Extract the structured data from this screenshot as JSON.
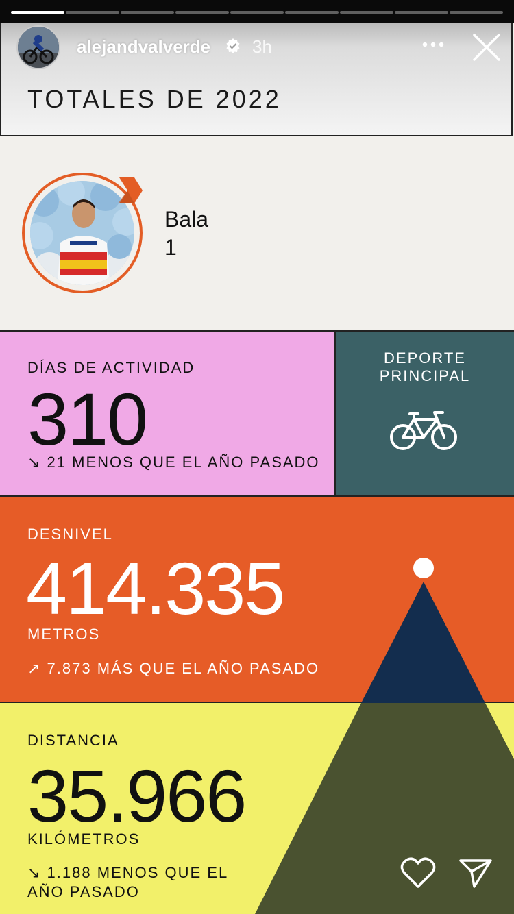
{
  "story": {
    "progress_segments": [
      1,
      0,
      0,
      0,
      0,
      0,
      0,
      0,
      0
    ],
    "current_segment_fill": 0.0,
    "username": "alejandvalverde",
    "time": "3h"
  },
  "banner": {
    "title": "TOTALES DE 2022"
  },
  "athlete": {
    "name": "Bala",
    "number": "1"
  },
  "activity": {
    "label": "DÍAS DE ACTIVIDAD",
    "value": "310",
    "change": "↘ 21 MENOS QUE EL AÑO PASADO"
  },
  "sport": {
    "label_line1": "DEPORTE",
    "label_line2": "PRINCIPAL",
    "icon": "bicycle-icon"
  },
  "elevation": {
    "label": "DESNIVEL",
    "value": "414.335",
    "unit": "METROS",
    "change": "↗ 7.873 MÁS QUE EL AÑO PASADO"
  },
  "distance": {
    "label": "DISTANCIA",
    "value": "35.966",
    "unit": "KILÓMETROS",
    "change_line1": "↘ 1.188 MENOS QUE EL",
    "change_line2": "AÑO PASADO"
  },
  "colors": {
    "activity_bg": "#f0a9e6",
    "sport_bg": "#3b6166",
    "elevation_bg": "#e65c27",
    "distance_bg": "#f2f06a",
    "mountain_top": "#132d4e",
    "mountain_base": "#4a5230",
    "accent": "#e35d25"
  }
}
